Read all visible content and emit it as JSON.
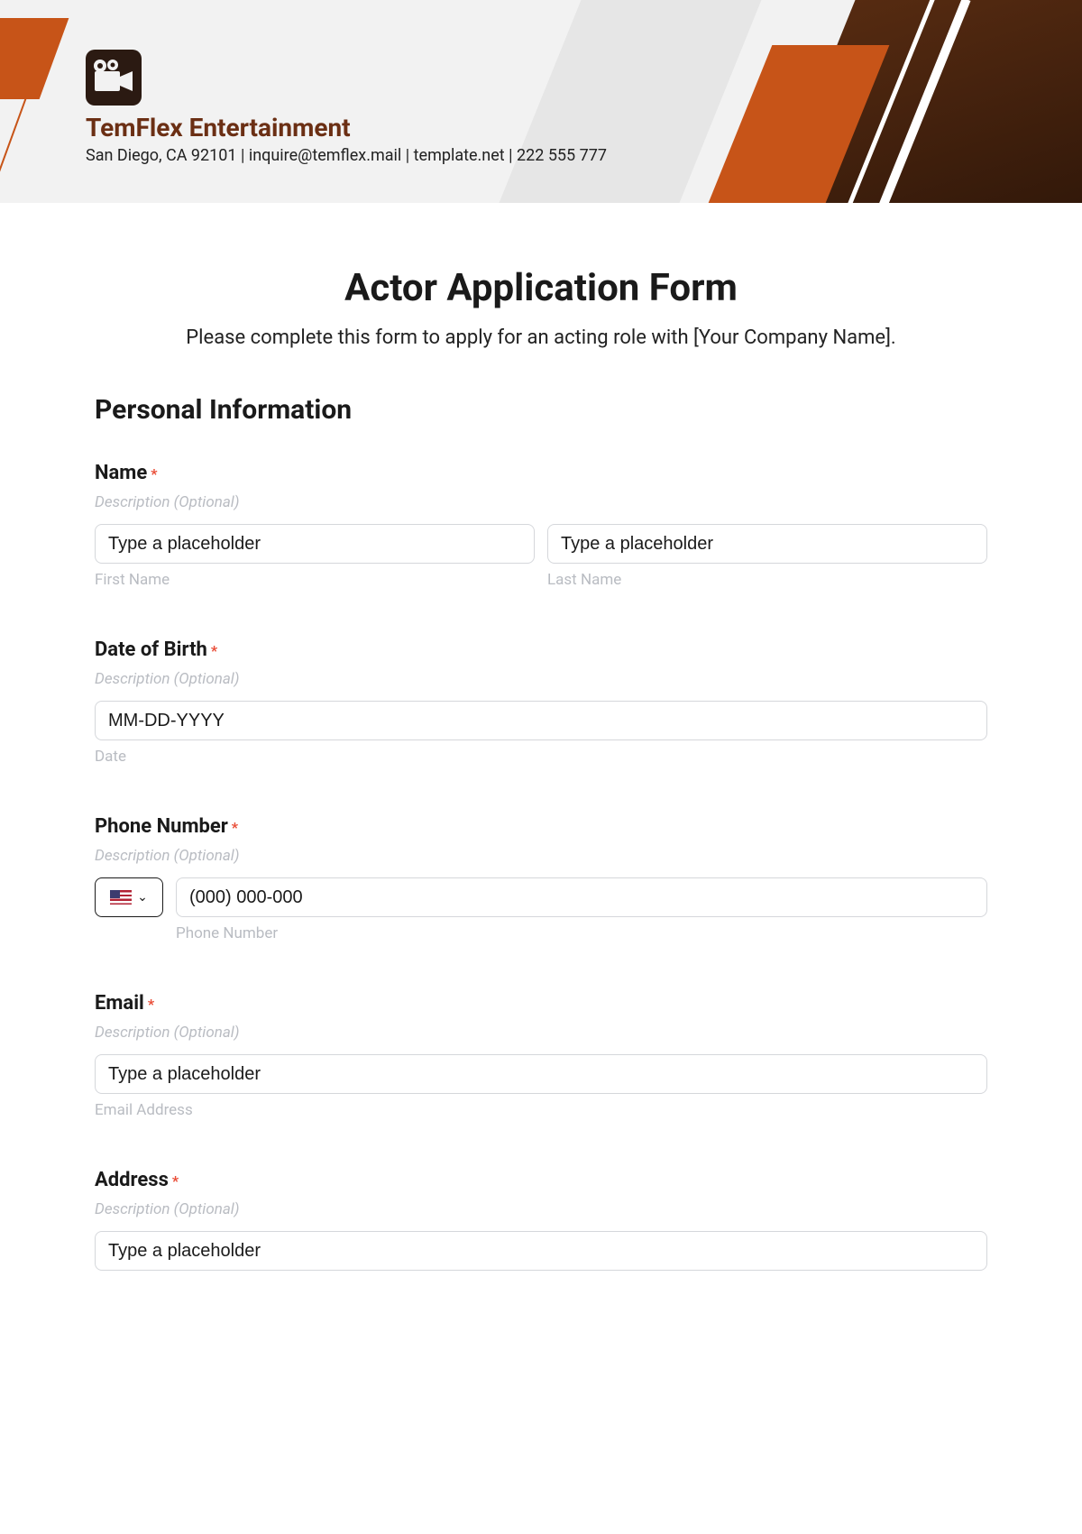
{
  "header": {
    "company_name": "TemFlex Entertainment",
    "contact_line": "San Diego, CA 92101 | inquire@temflex.mail | template.net | 222 555 777"
  },
  "form": {
    "title": "Actor Application Form",
    "intro": "Please complete this form to apply for an acting role with [Your Company Name].",
    "section_heading": "Personal Information",
    "desc_optional": "Description (Optional)",
    "required_mark": "*",
    "name": {
      "label": "Name",
      "first_placeholder": "Type a placeholder",
      "last_placeholder": "Type a placeholder",
      "first_sublabel": "First Name",
      "last_sublabel": "Last Name"
    },
    "dob": {
      "label": "Date of Birth",
      "placeholder": "MM-DD-YYYY",
      "sublabel": "Date"
    },
    "phone": {
      "label": "Phone Number",
      "placeholder": "(000) 000-000",
      "sublabel": "Phone Number"
    },
    "email": {
      "label": "Email",
      "placeholder": "Type a placeholder",
      "sublabel": "Email Address"
    },
    "address": {
      "label": "Address",
      "placeholder": "Type a placeholder"
    }
  }
}
